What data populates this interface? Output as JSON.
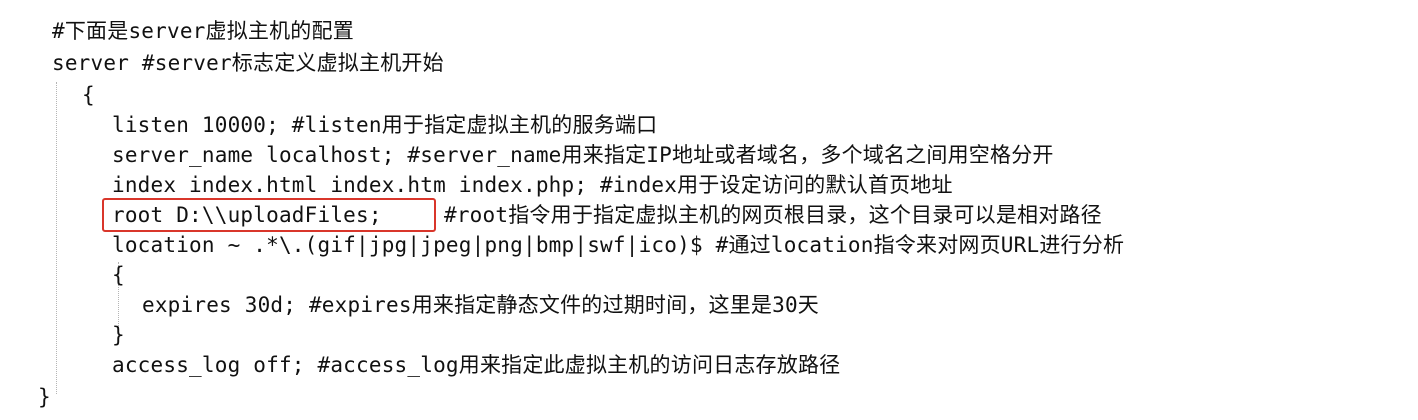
{
  "code": {
    "comment_header": "#下面是server虚拟主机的配置",
    "server_line": "server #server标志定义虚拟主机开始",
    "open_brace": "{",
    "listen_line": "listen 10000; #listen用于指定虚拟主机的服务端口",
    "server_name_line": "server_name localhost; #server_name用来指定IP地址或者域名，多个域名之间用空格分开",
    "index_line": "index index.html index.htm index.php; #index用于设定访问的默认首页地址",
    "root_directive": "root D:\\\\uploadFiles;",
    "root_comment": "#root指令用于指定虚拟主机的网页根目录，这个目录可以是相对路径",
    "location_line": "location ~ .*\\.(gif|jpg|jpeg|png|bmp|swf|ico)$ #通过location指令来对网页URL进行分析",
    "location_open_brace": "{",
    "expires_line": "expires 30d; #expires用来指定静态文件的过期时间，这里是30天",
    "location_close_brace": "}",
    "access_log_line": "access_log off; #access_log用来指定此虚拟主机的访问日志存放路径",
    "close_brace": "}"
  },
  "colors": {
    "highlight_border": "#d9362b",
    "text": "#111111"
  }
}
